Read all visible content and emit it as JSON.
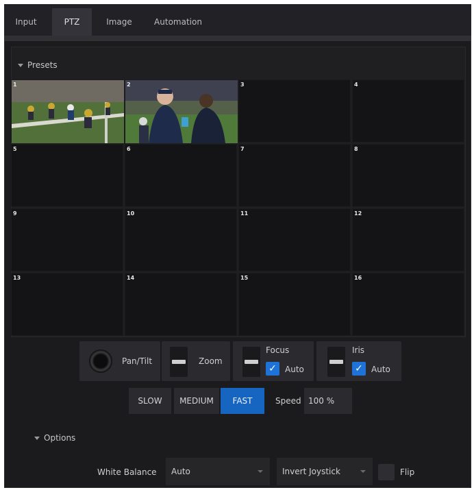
{
  "tabs": [
    {
      "label": "Input"
    },
    {
      "label": "PTZ"
    },
    {
      "label": "Image"
    },
    {
      "label": "Automation"
    }
  ],
  "presets": {
    "title": "Presets",
    "slots": [
      "1",
      "2",
      "3",
      "4",
      "5",
      "6",
      "7",
      "8",
      "9",
      "10",
      "11",
      "12",
      "13",
      "14",
      "15",
      "16"
    ],
    "slot1_thumbnail": "football-field-players",
    "slot2_thumbnail": "sideline-interview"
  },
  "controls": {
    "pan_tilt_label": "Pan/Tilt",
    "zoom_label": "Zoom",
    "focus_label": "Focus",
    "focus_auto_label": "Auto",
    "focus_auto_checked": true,
    "iris_label": "Iris",
    "iris_auto_label": "Auto",
    "iris_auto_checked": true
  },
  "speed": {
    "slow": "SLOW",
    "medium": "MEDIUM",
    "fast": "FAST",
    "selected": "FAST",
    "label": "Speed",
    "value": "100 %"
  },
  "options": {
    "title": "Options",
    "white_balance_label": "White Balance",
    "white_balance_value": "Auto",
    "invert_joystick_value": "Invert Joystick",
    "flip_label": "Flip",
    "flip_checked": false
  },
  "colors": {
    "accent": "#1665c1",
    "checkbox": "#1e72d8",
    "background": "#1b1b1e"
  }
}
